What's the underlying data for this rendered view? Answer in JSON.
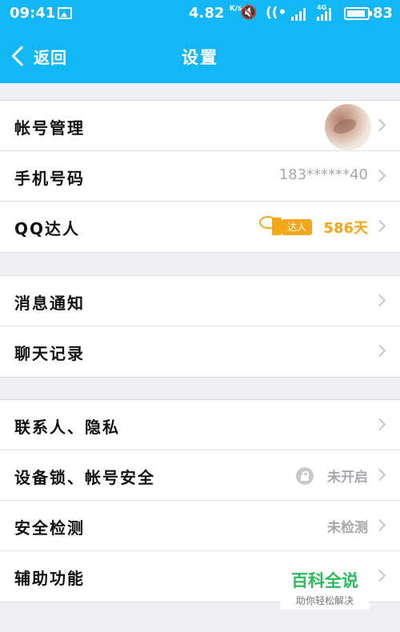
{
  "status_bar": {
    "time": "09:41",
    "speed": "4.82",
    "speed_unit": "K/s",
    "network": "4G",
    "battery": "83"
  },
  "header": {
    "back_label": "返回",
    "title": "设置"
  },
  "groups": [
    {
      "rows": [
        {
          "label": "帐号管理",
          "value": ""
        },
        {
          "label": "手机号码",
          "value": "183******40"
        },
        {
          "label": "QQ达人",
          "badge": "达人",
          "value": "586天"
        }
      ]
    },
    {
      "rows": [
        {
          "label": "消息通知",
          "value": ""
        },
        {
          "label": "聊天记录",
          "value": ""
        }
      ]
    },
    {
      "rows": [
        {
          "label": "联系人、隐私",
          "value": ""
        },
        {
          "label": "设备锁、帐号安全",
          "value": "未开启"
        },
        {
          "label": "安全检测",
          "value": "未检测"
        },
        {
          "label": "辅助功能",
          "value": ""
        }
      ]
    }
  ],
  "watermark": {
    "title": "百科全说",
    "subtitle": "助你轻松解决"
  },
  "colors": {
    "header": "#12b7f5",
    "gold": "#f5a515",
    "value_gray": "#a7a7ad",
    "background": "#eeeff3"
  }
}
